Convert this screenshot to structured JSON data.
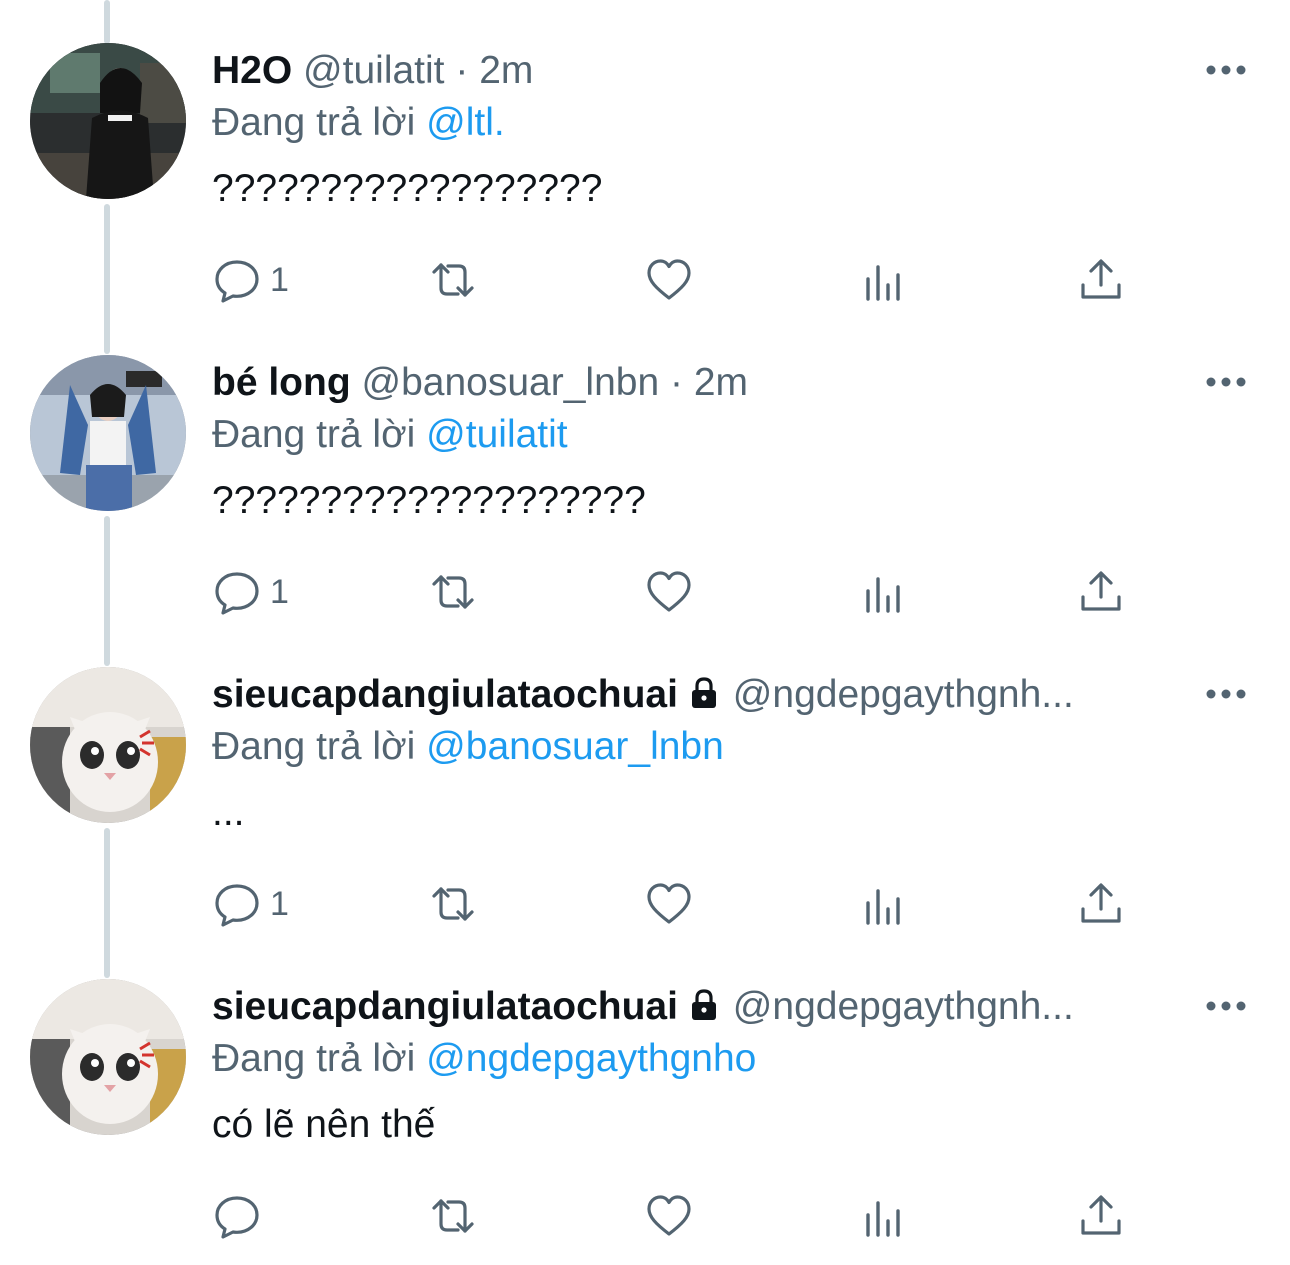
{
  "colors": {
    "text_primary": "#0f1419",
    "text_secondary": "#536471",
    "mention_blue": "#1d9bf0",
    "thread_line": "#cfd9de",
    "background": "#ffffff"
  },
  "icons": {
    "reply": "speech-bubble-icon",
    "retweet": "retweet-arrows-icon",
    "like": "heart-icon",
    "views": "bar-chart-icon",
    "share": "share-upload-icon",
    "more": "three-dots-icon",
    "protected": "lock-icon"
  },
  "tweets": [
    {
      "name": "H2O",
      "handle": "@tuilatit",
      "separator": "·",
      "time": "2m",
      "protected": false,
      "replying_label": "Đang trả lời",
      "replying_to": "@ltl.",
      "text": "??????????????????",
      "reply_count": "1"
    },
    {
      "name": "bé long",
      "handle": "@banosuar_lnbn",
      "separator": "·",
      "time": "2m",
      "protected": false,
      "replying_label": "Đang trả lời",
      "replying_to": "@tuilatit",
      "text": "????????????????????",
      "reply_count": "1"
    },
    {
      "name": "sieucapdangiulataochuai",
      "handle": "@ngdepgaythgnh...",
      "separator": "",
      "time": "",
      "protected": true,
      "replying_label": "Đang trả lời",
      "replying_to": "@banosuar_lnbn",
      "text": "...",
      "reply_count": "1"
    },
    {
      "name": "sieucapdangiulataochuai",
      "handle": "@ngdepgaythgnh...",
      "separator": "",
      "time": "",
      "protected": true,
      "replying_label": "Đang trả lời",
      "replying_to": "@ngdepgaythgnho",
      "text": "có lẽ nên thế",
      "reply_count": ""
    }
  ]
}
